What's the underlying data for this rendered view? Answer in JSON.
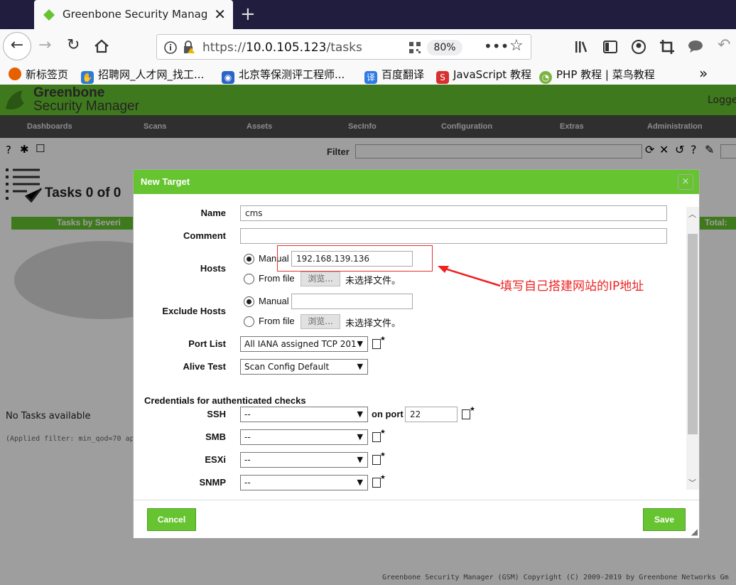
{
  "browser": {
    "tab_title": "Greenbone Security Manager",
    "tab_close": "✕",
    "new_tab": "+",
    "url_protocol": "https://",
    "url_host": "10.0.105.123",
    "url_path": "/tasks",
    "zoom": "80%",
    "bookmarks": [
      {
        "label": "新标签页",
        "color": "#e66000"
      },
      {
        "label": "招聘网_人才网_找工...",
        "color": "#2d7bd1"
      },
      {
        "label": "北京等保测评工程师...",
        "color": "#2a64c9"
      },
      {
        "label": "百度翻译",
        "color": "#2e7ae6"
      },
      {
        "label": "JavaScript 教程",
        "color": "#d83030"
      },
      {
        "label": "PHP 教程 | 菜鸟教程",
        "color": "#7cb342"
      }
    ]
  },
  "gsm": {
    "logo_line1": "Greenbone",
    "logo_line2": "Security Manager",
    "logged": "Logge",
    "menu": [
      "Dashboards",
      "Scans",
      "Assets",
      "SecInfo",
      "Configuration",
      "Extras",
      "Administration"
    ],
    "filter_label": "Filter",
    "tasks_title": "Tasks 0 of 0",
    "tasks_by_severity": "Tasks by Severi",
    "total_label": "Total:",
    "no_tasks": "No Tasks available",
    "applied_filter": "(Applied filter: min_qod=70 app",
    "footer": "Greenbone Security Manager (GSM) Copyright (C) 2009-2019 by Greenbone Networks Gm"
  },
  "dialog": {
    "title": "New Target",
    "close": "×",
    "name_label": "Name",
    "name_value": "cms",
    "comment_label": "Comment",
    "comment_value": "",
    "hosts_label": "Hosts",
    "manual_label": "Manual",
    "hosts_manual_value": "192.168.139.136",
    "from_file_label": "From file",
    "browse_label": "浏览...",
    "no_file": "未选择文件。",
    "exclude_hosts_label": "Exclude Hosts",
    "exclude_manual_value": "",
    "port_list_label": "Port List",
    "port_list_value": "All IANA assigned TCP 201",
    "alive_test_label": "Alive Test",
    "alive_test_value": "Scan Config Default",
    "credentials_heading": "Credentials for authenticated checks",
    "ssh_label": "SSH",
    "ssh_value": "--",
    "on_port_label": "on port",
    "ssh_port": "22",
    "smb_label": "SMB",
    "smb_value": "--",
    "esxi_label": "ESXi",
    "esxi_value": "--",
    "snmp_label": "SNMP",
    "snmp_value": "--",
    "cancel_label": "Cancel",
    "save_label": "Save"
  },
  "annotation": {
    "text": "填写自己搭建网站的IP地址",
    "color": "#e22222"
  },
  "colors": {
    "brand_green": "#66c430",
    "menu_dark": "#4c4c4c",
    "browser_tabbar": "#201d3f"
  }
}
